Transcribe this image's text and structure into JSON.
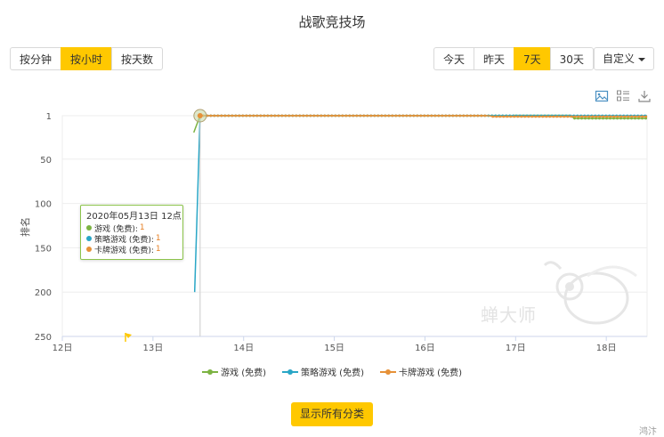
{
  "page": {
    "title": "战歌竞技场"
  },
  "granularity": {
    "buttons": [
      {
        "label": "按分钟",
        "active": false
      },
      {
        "label": "按小时",
        "active": true
      },
      {
        "label": "按天数",
        "active": false
      }
    ]
  },
  "range": {
    "buttons": [
      {
        "label": "今天",
        "active": false
      },
      {
        "label": "昨天",
        "active": false
      },
      {
        "label": "7天",
        "active": true
      },
      {
        "label": "30天",
        "active": false
      }
    ],
    "custom_label": "自定义"
  },
  "toolbar": {
    "icons": [
      "image-icon",
      "list-icon",
      "download-icon"
    ]
  },
  "chart_data": {
    "type": "line",
    "ylabel": "排名",
    "y_inverted": true,
    "ylim": [
      1,
      250
    ],
    "y_ticks": [
      "1",
      "50",
      "100",
      "150",
      "200",
      "250"
    ],
    "x_ticks": [
      "12日",
      "13日",
      "14日",
      "15日",
      "16日",
      "17日",
      "18日"
    ],
    "grid": true,
    "legend_position": "bottom",
    "series": [
      {
        "name": "游戏 (免费)",
        "color": "#7cb342",
        "points": [
          [
            13.45,
            20
          ],
          [
            13.52,
            1
          ],
          [
            17.0,
            1
          ],
          [
            17.6,
            1
          ],
          [
            17.65,
            4
          ],
          [
            18.45,
            4
          ]
        ]
      },
      {
        "name": "策略游戏 (免费)",
        "color": "#29a6c6",
        "points": [
          [
            13.46,
            200
          ],
          [
            13.52,
            1
          ],
          [
            18.45,
            1
          ]
        ]
      },
      {
        "name": "卡牌游戏 (免费)",
        "color": "#e69138",
        "points": [
          [
            13.52,
            1
          ],
          [
            16.7,
            1
          ],
          [
            16.75,
            2
          ],
          [
            18.45,
            2
          ]
        ]
      }
    ]
  },
  "tooltip": {
    "header": "2020年05月13日 12点",
    "rows": [
      {
        "name": "游戏 (免费):",
        "value": "1",
        "color": "#7cb342"
      },
      {
        "name": "策略游戏 (免费):",
        "value": "1",
        "color": "#29a6c6"
      },
      {
        "name": "卡牌游戏 (免费):",
        "value": "1",
        "color": "#e69138"
      }
    ]
  },
  "show_all_label": "显示所有分类",
  "watermark": "蝉大师",
  "corner_text": "鸿汴"
}
